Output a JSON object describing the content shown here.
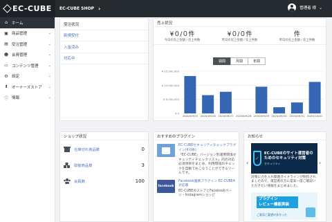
{
  "header": {
    "logo": "EC-CUBE",
    "shop_name": "EC-CUBE SHOP",
    "user": "管理者 様"
  },
  "sidebar": {
    "items": [
      {
        "label": "ホーム",
        "icon": "home-icon",
        "glyph": "⌂"
      },
      {
        "label": "商品管理",
        "icon": "cube-icon",
        "glyph": "▣"
      },
      {
        "label": "受注管理",
        "icon": "cart-icon",
        "glyph": "▤"
      },
      {
        "label": "会員管理",
        "icon": "users-icon",
        "glyph": "☻"
      },
      {
        "label": "コンテンツ管理",
        "icon": "content-icon",
        "glyph": "▭"
      },
      {
        "label": "設定",
        "icon": "gear-icon",
        "glyph": "⚙"
      },
      {
        "label": "オーナーズストア",
        "icon": "store-icon",
        "glyph": "⬆"
      },
      {
        "label": "情報",
        "icon": "info-icon",
        "glyph": "ⓘ"
      }
    ]
  },
  "orders": {
    "title": "受注状況",
    "items": [
      "新規受付",
      "入金済み",
      "対応中"
    ]
  },
  "sales": {
    "title": "売上状況",
    "stats": [
      {
        "value": "¥０/０件",
        "label": "今日の売上金額 / 売上件数"
      },
      {
        "value": "¥０/０件",
        "label": "昨日の売上金額 / 売上件数"
      },
      {
        "value": "件",
        "label": "昨日の売上金額 / 売上件数"
      }
    ],
    "tabs": [
      "週間",
      "月間",
      "年間"
    ],
    "selected_tab": "週間"
  },
  "chart_data": {
    "type": "bar",
    "categories": [
      "2020/09/25",
      "2020/09/26",
      "2020/09/27",
      "2020/09/28",
      "2020/09/29",
      "2020/09/30",
      "2020/09/31",
      "2020/10/01"
    ],
    "values": [
      13300000,
      6500000,
      7700000,
      0,
      9500000,
      2200000,
      3900000,
      11200000
    ],
    "yticks": [
      "¥ 15,000,000",
      "¥ 10,000,000",
      "¥ 5,000,000",
      "¥ 0"
    ],
    "ylim": [
      0,
      15000000
    ],
    "bar_color": "#3566b4",
    "grid": true
  },
  "shop": {
    "title": "ショップ状況",
    "rows": [
      {
        "label": "在庫切れ商品数",
        "value": "0",
        "icon": "box-icon"
      },
      {
        "label": "取扱商品数",
        "value": "3",
        "icon": "cubes-icon"
      },
      {
        "label": "会員数",
        "value": "100",
        "icon": "people-icon"
      }
    ]
  },
  "plugins": {
    "title": "おすすめのプラグイン",
    "items": [
      {
        "title": "EC-CUBEセキュリティチェックプラグイン(4.0系)",
        "desc": "「EC-CUBE」バージョン別運用環境セキュリティチェックリスト」内の対応必須項目をまとめ、利用環境のチェックを自動でおこなうことができるツールです。",
        "thumb_color": "#6fa3d8"
      },
      {
        "title": "Facebook連携プラグイン EC-CUBE4対応版",
        "desc": "EC-CUBEのストアとFacebookページ・Instagramショッピ",
        "thumb_color": "#3b5998",
        "thumb_text": "facebook"
      }
    ]
  },
  "news": {
    "title": "お知らせ",
    "banner1_title": "EC-CUBEのサイト運営者のためのセキュリティ対策",
    "banner1_sub": "セキュリティ",
    "desc": "対策に力を入れ関連ガイドラインが制作されましたので、運営者の方に是非一度ご確認いただきたい情報をまとめました。",
    "banner2_lines": [
      "プラグイン",
      "レビュー機能実装"
    ],
    "banner2_sub": "ご意見ご要望の多かった",
    "arrow_left": "‹",
    "arrow_right": "›"
  }
}
